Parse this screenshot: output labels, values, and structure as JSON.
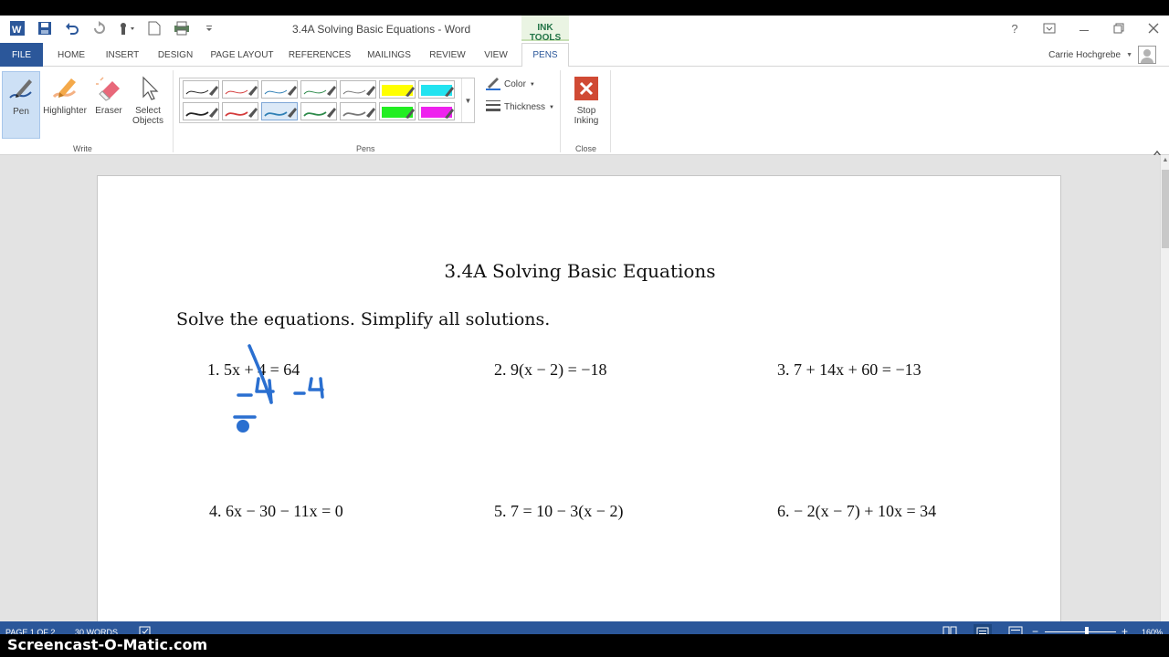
{
  "window": {
    "title": "3.4A Solving Basic Equations - Word",
    "context_label": "INK TOOLS"
  },
  "tabs": [
    "FILE",
    "HOME",
    "INSERT",
    "DESIGN",
    "PAGE LAYOUT",
    "REFERENCES",
    "MAILINGS",
    "REVIEW",
    "VIEW",
    "PENS"
  ],
  "active_tab": "PENS",
  "user": {
    "name": "Carrie Hochgrebe"
  },
  "ribbon": {
    "write": {
      "pen": "Pen",
      "highlighter": "Highlighter",
      "eraser": "Eraser",
      "select_line1": "Select",
      "select_line2": "Objects",
      "group": "Write"
    },
    "pens": {
      "group": "Pens",
      "color_label": "Color",
      "thickness_label": "Thickness"
    },
    "close": {
      "stop_line1": "Stop",
      "stop_line2": "Inking",
      "group": "Close"
    },
    "pen_colors_row1": [
      "#222222",
      "#d43b3b",
      "#2f7fb5",
      "#2d8a4a",
      "#777777",
      "#ffff00",
      "#22e3f0"
    ],
    "pen_colors_row2": [
      "#222222",
      "#d43b3b",
      "#2f7fb5",
      "#2d8a4a",
      "#777777",
      "#22ee22",
      "#ee22ee"
    ]
  },
  "document": {
    "title": "3.4A Solving Basic Equations",
    "instructions": "Solve the equations.  Simplify all solutions.",
    "equations": [
      "1. 5x + 4 = 64",
      "2. 9(x − 2) = −18",
      "3. 7 + 14x + 60 = −13",
      "4. 6x − 30 − 11x = 0",
      "5. 7 = 10 − 3(x − 2)",
      "6. − 2(x − 7) + 10x = 34"
    ],
    "ink_color": "#2a6fd0"
  },
  "status": {
    "page": "PAGE 1 OF 2",
    "words": "30 WORDS",
    "zoom": "160%"
  },
  "watermark": "Screencast-O-Matic.com"
}
